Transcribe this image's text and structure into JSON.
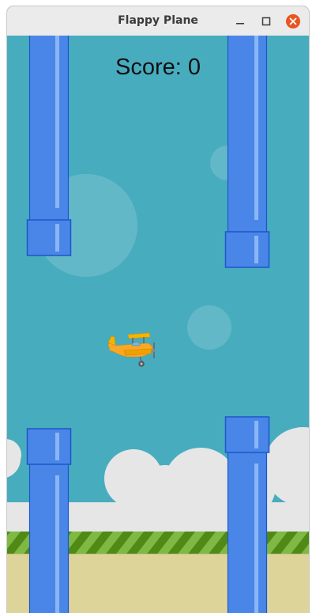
{
  "window": {
    "title": "Flappy Plane",
    "controls": [
      "minimize",
      "maximize",
      "close"
    ]
  },
  "game": {
    "score_text": "Score: 0",
    "player_icon": "biplane-icon",
    "colors": {
      "sky": "#48acbf",
      "pipe": "#4a86e8",
      "pipe_border": "#1b57c9",
      "pipe_highlight": "#8ab6f5",
      "cloud": "#e6e6e6",
      "grass_dark": "#4f8a17",
      "grass_light": "#7fb843",
      "ground": "#ddd49a",
      "plane": "#f9a825",
      "close_button": "#e95420"
    }
  }
}
